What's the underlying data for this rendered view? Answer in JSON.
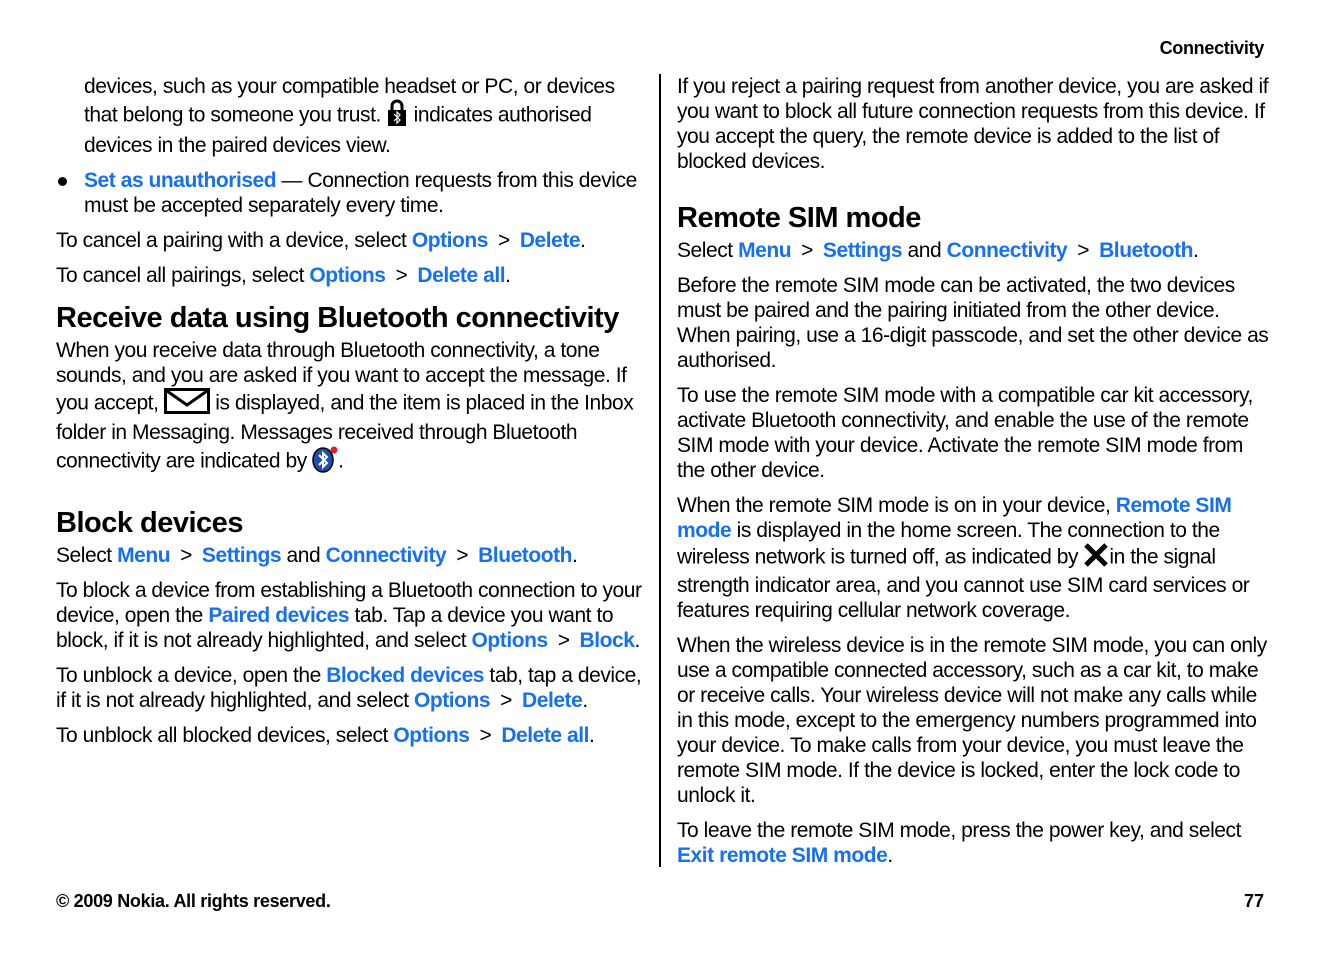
{
  "header": {
    "section": "Connectivity"
  },
  "left": {
    "intro_lines": [
      "devices, such as your compatible headset or PC, or devices that belong to someone you trust.",
      "indicates authorised devices in the paired devices view."
    ],
    "bullet": {
      "link": "Set as unauthorised",
      "text": " — Connection requests from this device must be accepted separately every time."
    },
    "cancel_pairing": {
      "text": "To cancel a pairing with a device, select ",
      "link1": "Options",
      "link2": "Delete"
    },
    "cancel_all": {
      "text": "To cancel all pairings, select ",
      "link1": "Options",
      "link2": "Delete all"
    },
    "receive_heading": "Receive data using Bluetooth connectivity",
    "receive_text_1": "When you receive data through Bluetooth connectivity, a tone sounds, and you are asked if you want to accept the message. If you accept,",
    "receive_text_2": "is displayed, and the item is placed in the Inbox folder in Messaging. Messages received through Bluetooth connectivity are indicated by",
    "block_heading": "Block devices",
    "block_path": {
      "select": "Select ",
      "menu": "Menu",
      "settings": "Settings",
      "and": " and ",
      "connectivity": "Connectivity",
      "bluetooth": "Bluetooth"
    },
    "block_text": {
      "a": "To block a device from establishing a Bluetooth connection to your device, open the ",
      "tab": "Paired devices",
      "b": " tab. Tap a device you want to block, if it is not already highlighted, and select ",
      "link1": "Options",
      "link2": "Block"
    },
    "unblock_text": {
      "a": "To unblock a device, open the ",
      "tab": "Blocked devices",
      "b": " tab, tap a device, if it is not already highlighted, and select ",
      "link1": "Options",
      "link2": "Delete"
    },
    "unblock_all": {
      "a": "To unblock all blocked devices, select ",
      "link1": "Options",
      "link2": "Delete all"
    }
  },
  "right": {
    "reject_text": "If you reject a pairing request from another device, you are asked if you want to block all future connection requests from this device. If you accept the query, the remote device is added to the list of blocked devices.",
    "remote_heading": "Remote SIM mode",
    "remote_path": {
      "select": "Select ",
      "menu": "Menu",
      "settings": "Settings",
      "and": " and ",
      "connectivity": "Connectivity",
      "bluetooth": "Bluetooth"
    },
    "before_text": "Before the remote SIM mode can be activated, the two devices must be paired and the pairing initiated from the other device. When pairing, use a 16-digit passcode, and set the other device as authorised.",
    "use_text": "To use the remote SIM mode with a compatible car kit accessory, activate Bluetooth connectivity, and enable the use of the remote SIM mode with your device. Activate the remote SIM mode from the other device.",
    "when_on": {
      "a": "When the remote SIM mode is on in your device, ",
      "link": "Remote SIM mode",
      "b": " is displayed in the home screen. The connection to the wireless network is turned off, as indicated by",
      "c": "in the signal strength indicator area, and you cannot use SIM card services or features requiring cellular network coverage."
    },
    "wireless_text": "When the wireless device is in the remote SIM mode, you can only use a compatible connected accessory, such as a car kit, to make or receive calls. Your wireless device will not make any calls while in this mode, except to the emergency numbers programmed into your device. To make calls from your device, you must leave the remote SIM mode. If the device is locked, enter the lock code to unlock it.",
    "leave_text": {
      "a": "To leave the remote SIM mode, press the power key, and select ",
      "link": "Exit remote SIM mode"
    }
  },
  "footer": {
    "copyright": "© 2009 Nokia. All rights reserved.",
    "page_number": "77"
  },
  "symbols": {
    "gt": ">",
    "period": "."
  },
  "colors": {
    "link": "#1670ef"
  }
}
